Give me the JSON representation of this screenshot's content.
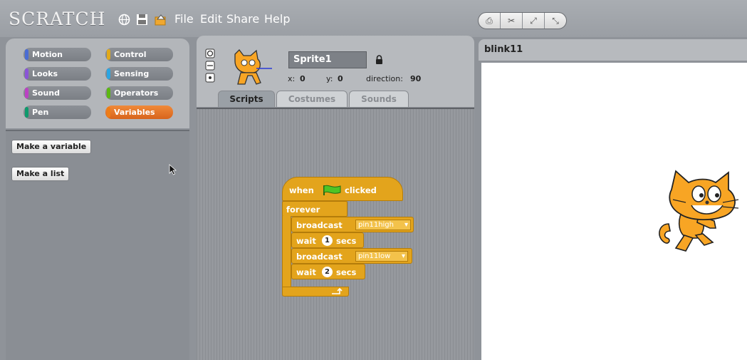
{
  "app": {
    "logo": "SCRATCH",
    "menu": [
      "File",
      "Edit",
      "Share",
      "Help"
    ],
    "toolbar_icons": [
      "stamp-icon",
      "scissors-icon",
      "grow-icon",
      "shrink-icon"
    ]
  },
  "palette": {
    "categories": [
      {
        "label": "Motion",
        "color": "#4a6cd4"
      },
      {
        "label": "Control",
        "color": "#e1a91a"
      },
      {
        "label": "Looks",
        "color": "#8a55d7"
      },
      {
        "label": "Sensing",
        "color": "#2ca5e2"
      },
      {
        "label": "Sound",
        "color": "#bb42c3"
      },
      {
        "label": "Operators",
        "color": "#5cb712"
      },
      {
        "label": "Pen",
        "color": "#0e9a6c"
      },
      {
        "label": "Variables",
        "color": "#ee7d16"
      }
    ],
    "active_category": "Variables",
    "buttons": {
      "make_variable": "Make a variable",
      "make_list": "Make a list"
    }
  },
  "sprite": {
    "name": "Sprite1",
    "x_label": "x:",
    "x": "0",
    "y_label": "y:",
    "y": "0",
    "direction_label": "direction:",
    "direction": "90"
  },
  "tabs": [
    "Scripts",
    "Costumes",
    "Sounds"
  ],
  "active_tab": "Scripts",
  "script": {
    "hat": {
      "when": "when",
      "clicked": "clicked"
    },
    "forever": "forever",
    "broadcast1": {
      "label": "broadcast",
      "message": "pin11high"
    },
    "wait1": {
      "label": "wait",
      "value": "1",
      "unit": "secs"
    },
    "broadcast2": {
      "label": "broadcast",
      "message": "pin11low"
    },
    "wait2": {
      "label": "wait",
      "value": "2",
      "unit": "secs"
    }
  },
  "stage": {
    "title": "blink11"
  }
}
